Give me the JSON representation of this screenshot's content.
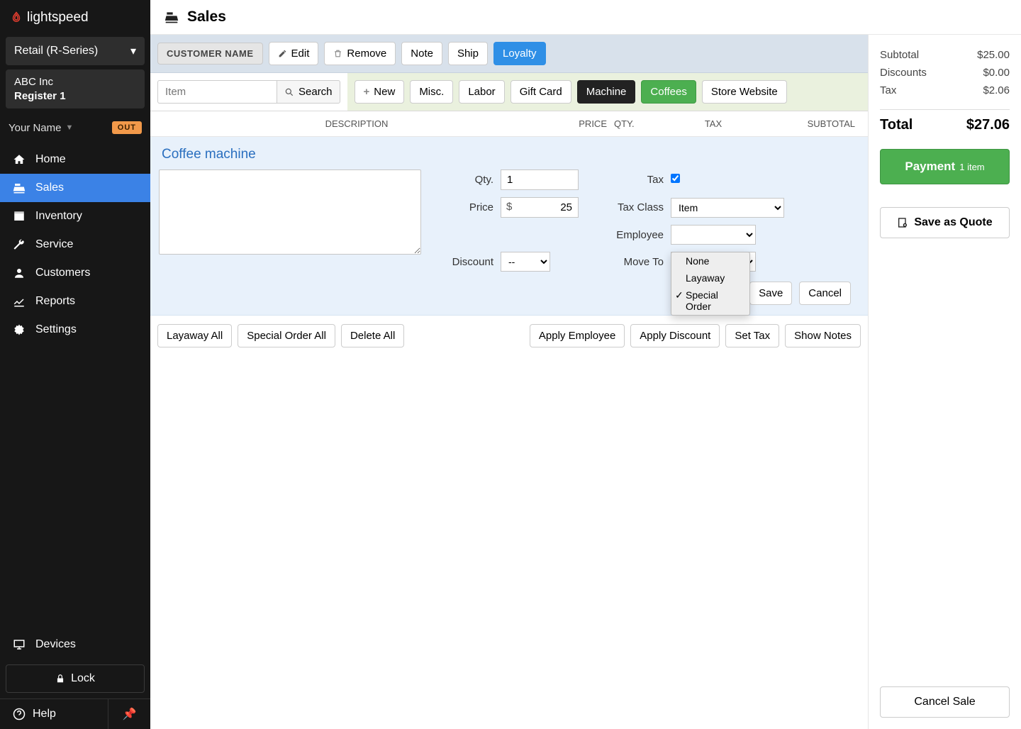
{
  "brand": "lightspeed",
  "product_selector": "Retail (R-Series)",
  "company": {
    "name": "ABC Inc",
    "register": "Register 1"
  },
  "user": {
    "name": "Your Name",
    "status_badge": "OUT"
  },
  "nav": {
    "home": "Home",
    "sales": "Sales",
    "inventory": "Inventory",
    "service": "Service",
    "customers": "Customers",
    "reports": "Reports",
    "settings": "Settings",
    "devices": "Devices",
    "lock": "Lock",
    "help": "Help"
  },
  "page": {
    "title": "Sales"
  },
  "toolbar": {
    "customer_name": "CUSTOMER NAME",
    "edit": "Edit",
    "remove": "Remove",
    "note": "Note",
    "ship": "Ship",
    "loyalty": "Loyalty"
  },
  "search": {
    "placeholder": "Item",
    "button": "Search"
  },
  "quick": {
    "new": "New",
    "misc": "Misc.",
    "labor": "Labor",
    "giftcard": "Gift Card",
    "machine": "Machine",
    "coffees": "Coffees",
    "store": "Store Website"
  },
  "columns": {
    "desc": "DESCRIPTION",
    "price": "PRICE",
    "qty": "QTY.",
    "tax": "TAX",
    "subtotal": "SUBTOTAL"
  },
  "line": {
    "title": "Coffee machine",
    "labels": {
      "qty": "Qty.",
      "price": "Price",
      "discount": "Discount",
      "tax": "Tax",
      "taxclass": "Tax Class",
      "employee": "Employee",
      "moveto": "Move To"
    },
    "qty": "1",
    "currency": "$",
    "price": "25",
    "discount": "--",
    "tax_checked": true,
    "taxclass": "Item",
    "save": "Save",
    "cancel": "Cancel"
  },
  "moveto_options": {
    "none": "None",
    "layaway": "Layaway",
    "special": "Special Order"
  },
  "bulk": {
    "layaway_all": "Layaway All",
    "special_all": "Special Order All",
    "delete_all": "Delete All",
    "apply_employee": "Apply Employee",
    "apply_discount": "Apply Discount",
    "set_tax": "Set Tax",
    "show_notes": "Show Notes"
  },
  "totals": {
    "subtotal_label": "Subtotal",
    "subtotal": "$25.00",
    "discounts_label": "Discounts",
    "discounts": "$0.00",
    "tax_label": "Tax",
    "tax": "$2.06",
    "total_label": "Total",
    "total": "$27.06",
    "payment": "Payment",
    "payment_sub": "1 item",
    "save_quote": "Save as Quote",
    "cancel_sale": "Cancel Sale"
  }
}
